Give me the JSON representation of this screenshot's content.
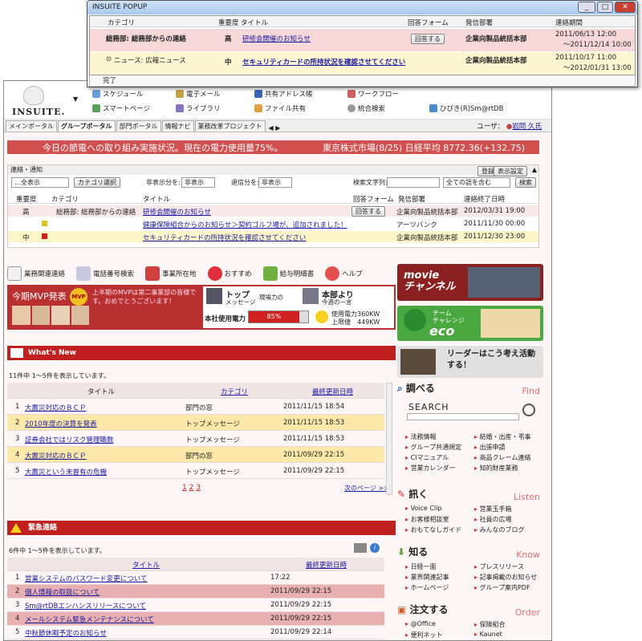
{
  "popup": {
    "title": "INSUITE POPUP",
    "columns": [
      "カテゴリ",
      "重要度",
      "タイトル",
      "回答フォーム",
      "発信部署",
      "連絡期間"
    ],
    "rows": [
      {
        "category": "総務部: 総務部からの連絡",
        "priority": "高",
        "title": "研修会開催のお知らせ",
        "answer": "回答する",
        "dept": "企業向製品統括本部",
        "period1": "2011/06/13 12:00",
        "period2": "～2011/12/14 10:00"
      },
      {
        "category": "ニュース: 広報ニュース",
        "priority": "中",
        "title": "セキュリティカードの所持状況を確認させてください",
        "answer": "",
        "dept": "企業向製品統括本部",
        "period1": "2011/10/17 11:00",
        "period2": "～2012/01/31 13:00"
      }
    ],
    "footer": "完了"
  },
  "nav": {
    "items": [
      "スケジュール",
      "電子メール",
      "共有アドレス帳",
      "ワークフロー",
      "スマートページ",
      "ライブラリ",
      "ファイル共有",
      "統合検索",
      "ひびき(R)Sm@rtDB"
    ],
    "logo": "INSUITE."
  },
  "tabs": [
    "メインポータル",
    "グループポータル",
    "部門ポータル",
    "情報ナビ",
    "業務改革プロジェクト"
  ],
  "user": "ユーザ：",
  "user_name": "岩岡 久氏",
  "banner": {
    "left": "今日の節電への取り組み実施状況。現在の電力使用量75%。",
    "right": "東京株式市場(8/25) 日経平均 8772.36(+132.75)"
  },
  "notice": {
    "title": "連絡・通知",
    "head_buttons": [
      "登録",
      "表示設定"
    ],
    "filter_category": "…全表示",
    "filter_button": "カテゴリ選択",
    "hidden_label": "非表示分を:",
    "hidden_value": "非表示",
    "retire_label": "退信分を:",
    "retire_value": "非表示",
    "search_label": "検索文字列:",
    "search_mode": "全ての語を含む",
    "search_button": "検索",
    "cols": [
      "重要度",
      "カテゴリ",
      "タイトル",
      "回答フォーム",
      "発信部署",
      "連絡終了日時"
    ],
    "rows": [
      {
        "priority": "高",
        "category": "総務部: 総務部からの連絡",
        "title": "研修会開催のお知らせ",
        "answer": "回答する",
        "dept": "企業向製品統括本部",
        "date": "2012/03/31 19:00"
      },
      {
        "priority": "",
        "category": "",
        "title": "健康保険組合からのお知らせ＞契約ゴルフ場が、追加されました！",
        "answer": "",
        "dept": "アーツバンク",
        "date": "2011/11/30 00:00"
      },
      {
        "priority": "中",
        "category": "",
        "title": "セキュリティカードの所持状況を確認させてください",
        "answer": "",
        "dept": "企業向製品統括本部",
        "date": "2011/12/30 23:00"
      }
    ]
  },
  "iconstrip": [
    "業務関連連絡",
    "電話番号検索",
    "事業所在地",
    "おすすめ",
    "給与明細書",
    "ヘルプ"
  ],
  "mvp": {
    "title": "今期MVP発表",
    "badge": "MVP",
    "text": "上半期のMVPは第二事業部の皆様です。おめでとうございます！",
    "top_label": "トップ",
    "top_sub": "メッセージ",
    "top_text": "現場力の",
    "dept_label": "本部より",
    "dept_sub": "今週の一言",
    "power_label": "本社使用電力",
    "power_pct": "85%",
    "power_fraction": 0.85,
    "used": "使用電力360KW",
    "limit": "上限値　449KW"
  },
  "whatsnew": {
    "title": "What's New",
    "count": "11件中 1〜5件を表示しています。",
    "cols": [
      "タイトル",
      "カテゴリ",
      "最終更新日時"
    ],
    "rows": [
      {
        "n": "1",
        "title": "大震災対応のＢＣＰ",
        "cat": "部門の窓",
        "date": "2011/11/15 18:54"
      },
      {
        "n": "2",
        "title": "2010年度の決算を発表",
        "cat": "トップメッセージ",
        "date": "2011/11/15 18:53"
      },
      {
        "n": "3",
        "title": "証券会社ではリスク管理職数",
        "cat": "トップメッセージ",
        "date": "2011/11/15 18:53"
      },
      {
        "n": "4",
        "title": "大震災対応のＢＣＰ",
        "cat": "部門の窓",
        "date": "2011/09/29 22:15"
      },
      {
        "n": "5",
        "title": "大震災という未曾有の危機",
        "cat": "トップメッセージ",
        "date": "2011/09/29 22:15"
      }
    ],
    "pages": [
      "1",
      "2",
      "3"
    ],
    "next": "次のページ >>"
  },
  "urgent": {
    "title": "緊急連絡",
    "count": "6件中 1〜5件を表示しています。",
    "cols": [
      "タイトル",
      "最終更新日時"
    ],
    "rows": [
      {
        "n": "1",
        "title": "営業システムのパスワード変更について",
        "date": "17:22"
      },
      {
        "n": "2",
        "title": "個人情報の取扱について",
        "date": "2011/09/29 22:15"
      },
      {
        "n": "3",
        "title": "Sm@rtDBエンハンスリリースについて",
        "date": "2011/09/29 22:15"
      },
      {
        "n": "4",
        "title": "メールシステム緊急メンテナンスについて",
        "date": "2011/09/29 22:15"
      },
      {
        "n": "5",
        "title": "中秋節休暇予定のお知らせ",
        "date": "2011/09/29 22:14"
      }
    ]
  },
  "right": {
    "movie": "movie\nチャンネル",
    "eco_1": "チーム",
    "eco_2": "チャレンジ",
    "eco_3": "eco",
    "leader": "リーダーはこう考え活動する！",
    "find": {
      "jp": "調べる",
      "en": "Find",
      "search": "SEARCH",
      "links": [
        "法務情報",
        "結婚・出産・弔事",
        "グループ共通規定",
        "出張申請",
        "CIマニュアル",
        "商品クレーム連絡",
        "営業カレンダー",
        "知的財産業務"
      ]
    },
    "listen": {
      "jp": "訊く",
      "en": "Listen",
      "links": [
        "Voice Clip",
        "営業玉手箱",
        "お客様相談室",
        "社員の広場",
        "おもてなしガイド",
        "みんなのブログ"
      ]
    },
    "know": {
      "jp": "知る",
      "en": "Know",
      "links": [
        "日経一面",
        "プレスリリース",
        "業界関連記事",
        "記事掲載のお知らせ",
        "ホームページ",
        "グループ案内PDF"
      ]
    },
    "order": {
      "jp": "注文する",
      "en": "Order",
      "links": [
        "@Office",
        "保険組合",
        "便利ネット",
        "Kaunet"
      ]
    }
  },
  "colors": {
    "red": "#c02020",
    "banner": "#d05050",
    "highlight": "#fce8a8",
    "pink": "#e8b0b0"
  }
}
